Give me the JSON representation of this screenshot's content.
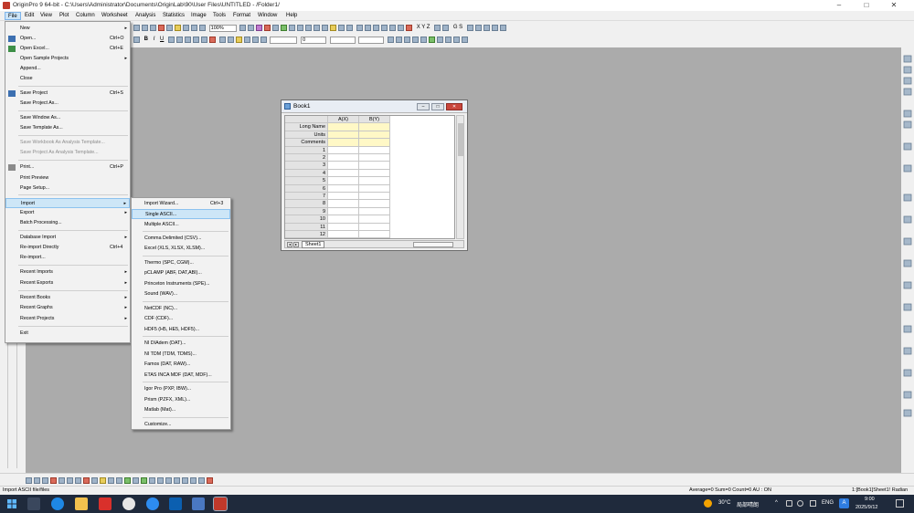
{
  "window": {
    "title": "OriginPro 9 64-bit - C:\\Users\\Administrator\\Documents\\OriginLab\\90\\User Files\\UNTITLED - /Folder1/",
    "minimize": "–",
    "maximize": "□",
    "close": "✕"
  },
  "menubar": [
    "File",
    "Edit",
    "View",
    "Plot",
    "Column",
    "Worksheet",
    "Analysis",
    "Statistics",
    "Image",
    "Tools",
    "Format",
    "Window",
    "Help"
  ],
  "toolbar": {
    "zoom": "100%",
    "font_size": "0",
    "bold": "B",
    "italic": "I",
    "underline": "U",
    "xyz_label": "X Y Z",
    "gs_label": "G S"
  },
  "file_menu": {
    "items": [
      {
        "label": "New",
        "shortcut": "",
        "submenu": true,
        "disabled": false,
        "icon": ""
      },
      {
        "label": "Open...",
        "shortcut": "Ctrl+O",
        "submenu": false,
        "disabled": false,
        "icon": "open-folder-icon"
      },
      {
        "label": "Open Excel...",
        "shortcut": "Ctrl+E",
        "submenu": false,
        "disabled": false,
        "icon": "excel-icon"
      },
      {
        "label": "Open Sample Projects",
        "shortcut": "",
        "submenu": true,
        "disabled": false,
        "icon": ""
      },
      {
        "label": "Append...",
        "shortcut": "",
        "submenu": false,
        "disabled": false,
        "icon": ""
      },
      {
        "label": "Close",
        "shortcut": "",
        "submenu": false,
        "disabled": false,
        "icon": ""
      },
      {
        "label": "Save Project",
        "shortcut": "Ctrl+S",
        "submenu": false,
        "disabled": false,
        "icon": "save-icon"
      },
      {
        "label": "Save Project As...",
        "shortcut": "",
        "submenu": false,
        "disabled": false,
        "icon": ""
      },
      {
        "label": "Save Window As...",
        "shortcut": "",
        "submenu": false,
        "disabled": false,
        "icon": ""
      },
      {
        "label": "Save Template As...",
        "shortcut": "",
        "submenu": false,
        "disabled": false,
        "icon": ""
      },
      {
        "label": "Save Workbook As Analysis Template...",
        "shortcut": "",
        "submenu": false,
        "disabled": true,
        "icon": ""
      },
      {
        "label": "Save Project As Analysis Template...",
        "shortcut": "",
        "submenu": false,
        "disabled": true,
        "icon": ""
      },
      {
        "label": "Print...",
        "shortcut": "Ctrl+P",
        "submenu": false,
        "disabled": false,
        "icon": "print-icon"
      },
      {
        "label": "Print Preview",
        "shortcut": "",
        "submenu": false,
        "disabled": false,
        "icon": ""
      },
      {
        "label": "Page Setup...",
        "shortcut": "",
        "submenu": false,
        "disabled": false,
        "icon": ""
      },
      {
        "label": "Import",
        "shortcut": "",
        "submenu": true,
        "disabled": false,
        "icon": ""
      },
      {
        "label": "Export",
        "shortcut": "",
        "submenu": true,
        "disabled": false,
        "icon": ""
      },
      {
        "label": "Batch Processing...",
        "shortcut": "",
        "submenu": false,
        "disabled": false,
        "icon": ""
      },
      {
        "label": "Database Import",
        "shortcut": "",
        "submenu": true,
        "disabled": false,
        "icon": ""
      },
      {
        "label": "Re-import Directly",
        "shortcut": "Ctrl+4",
        "submenu": false,
        "disabled": false,
        "icon": ""
      },
      {
        "label": "Re-import...",
        "shortcut": "",
        "submenu": false,
        "disabled": false,
        "icon": ""
      },
      {
        "label": "Recent Imports",
        "shortcut": "",
        "submenu": true,
        "disabled": false,
        "icon": ""
      },
      {
        "label": "Recent Exports",
        "shortcut": "",
        "submenu": true,
        "disabled": false,
        "icon": ""
      },
      {
        "label": "Recent Books",
        "shortcut": "",
        "submenu": true,
        "disabled": false,
        "icon": ""
      },
      {
        "label": "Recent Graphs",
        "shortcut": "",
        "submenu": true,
        "disabled": false,
        "icon": ""
      },
      {
        "label": "Recent Projects",
        "shortcut": "",
        "submenu": true,
        "disabled": false,
        "icon": ""
      },
      {
        "label": "Exit",
        "shortcut": "",
        "submenu": false,
        "disabled": false,
        "icon": ""
      }
    ]
  },
  "import_menu": {
    "items": [
      {
        "label": "Import Wizard...",
        "shortcut": "Ctrl+3"
      },
      {
        "label": "Single ASCII..."
      },
      {
        "label": "Multiple ASCII..."
      },
      {
        "label": "Comma Delimited (CSV)..."
      },
      {
        "label": "Excel (XLS, XLSX, XLSM)..."
      },
      {
        "label": "Thermo (SPC, CGM)..."
      },
      {
        "label": "pCLAMP (ABF, DAT,ABI)..."
      },
      {
        "label": "Princeton Instruments (SPE)..."
      },
      {
        "label": "Sound (WAV)..."
      },
      {
        "label": "NetCDF (NC)..."
      },
      {
        "label": "CDF (CDF)..."
      },
      {
        "label": "HDF5 (H5, HE5, HDF5)..."
      },
      {
        "label": "NI DIAdem (DAT)..."
      },
      {
        "label": "NI TDM (TDM, TDMS)..."
      },
      {
        "label": "Famos (DAT, RAW)..."
      },
      {
        "label": "ETAS INCA MDF (DAT, MDF)..."
      },
      {
        "label": "Igor Pro (PXP, IBW)..."
      },
      {
        "label": "Prism (PZFX, XML)..."
      },
      {
        "label": "Matlab (Mat)..."
      },
      {
        "label": "Customize..."
      }
    ],
    "highlighted": "Single ASCII..."
  },
  "workbook": {
    "title": "Book1",
    "columns": [
      "A(X)",
      "B(Y)"
    ],
    "label_rows": [
      "Long Name",
      "Units",
      "Comments"
    ],
    "rows": [
      "1",
      "2",
      "3",
      "4",
      "5",
      "6",
      "7",
      "8",
      "9",
      "10",
      "11",
      "12"
    ],
    "sheet_tab": "Sheet1"
  },
  "status": {
    "hint": "Import ASCII file/files",
    "stats": "Average=0 Sum=0 Count=0 AU : ON",
    "location": "1:[Book1]Sheet1! Radian"
  },
  "taskbar": {
    "weather": "30°C",
    "weather_desc": "局部晴朗",
    "lang": "ENG",
    "time": "9:00",
    "date": "2025/9/12"
  },
  "colors": {
    "workspace": "#ababab",
    "menu_highlight": "#cde6f7",
    "taskbar": "#1f2a3c",
    "yellow_cells": "#fff8c6"
  }
}
